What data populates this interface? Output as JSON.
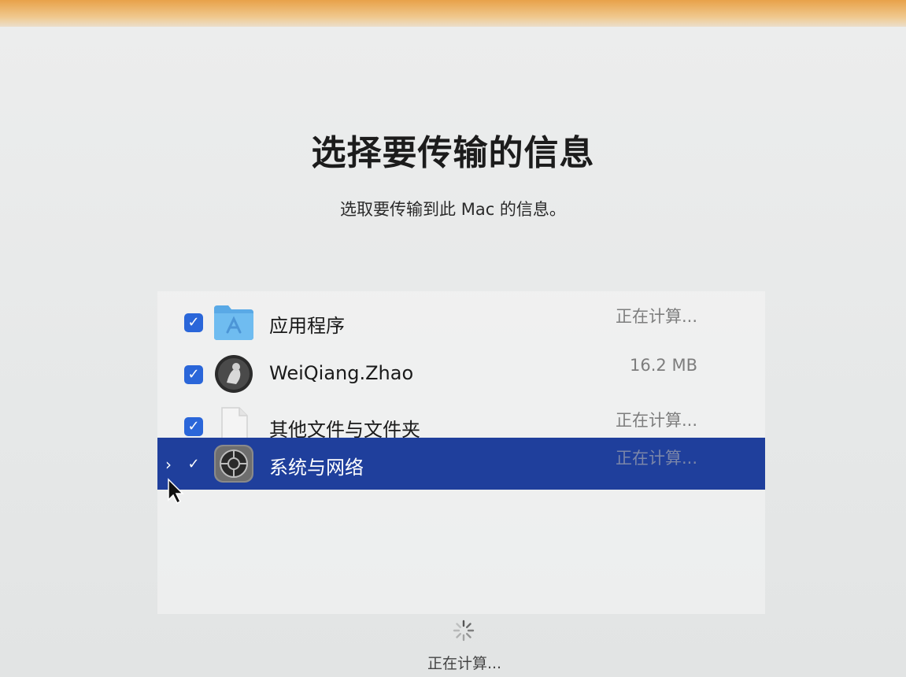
{
  "page": {
    "title": "选择要传输的信息",
    "subtitle": "选取要传输到此 Mac 的信息。"
  },
  "items": [
    {
      "label": "应用程序",
      "size": "正在计算...",
      "checked": true,
      "icon": "applications-folder-icon"
    },
    {
      "label": "WeiQiang.Zhao",
      "size": "16.2 MB",
      "checked": true,
      "icon": "user-avatar-icon"
    },
    {
      "label": "其他文件与文件夹",
      "size": "正在计算...",
      "checked": true,
      "icon": "document-icon"
    },
    {
      "label": "系统与网络",
      "size": "正在计算...",
      "checked": true,
      "icon": "system-preferences-icon",
      "selected": true
    }
  ],
  "footer": {
    "status": "正在计算..."
  },
  "colors": {
    "selection": "#1f3f9c",
    "checkbox": "#2a66d9",
    "accent_top": "#e8a24a"
  }
}
